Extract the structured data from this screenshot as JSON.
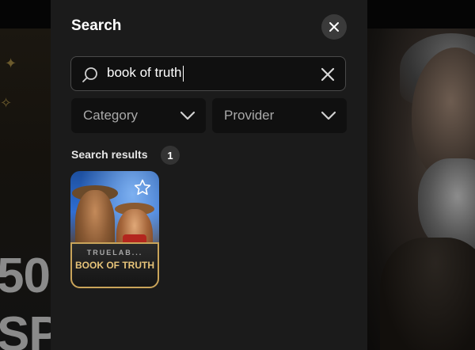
{
  "background": {
    "promo_line1": "50",
    "promo_line2": "SP"
  },
  "modal": {
    "title": "Search",
    "close_icon": "close-icon",
    "search": {
      "value": "book of truth",
      "icon": "search-icon",
      "clear_icon": "clear-icon"
    },
    "filters": [
      {
        "label": "Category",
        "icon": "chevron-down-icon"
      },
      {
        "label": "Provider",
        "icon": "chevron-down-icon"
      }
    ],
    "results": {
      "label": "Search results",
      "count": "1",
      "items": [
        {
          "provider": "TRUELAB...",
          "name": "BOOK OF TRUTH",
          "favorite_icon": "star-icon"
        }
      ]
    }
  },
  "colors": {
    "panel": "#1b1b1b",
    "input_bg": "#101010",
    "accent_gold": "#c9a45a",
    "text_primary": "#ffffff",
    "text_muted": "#a9a9a9"
  }
}
